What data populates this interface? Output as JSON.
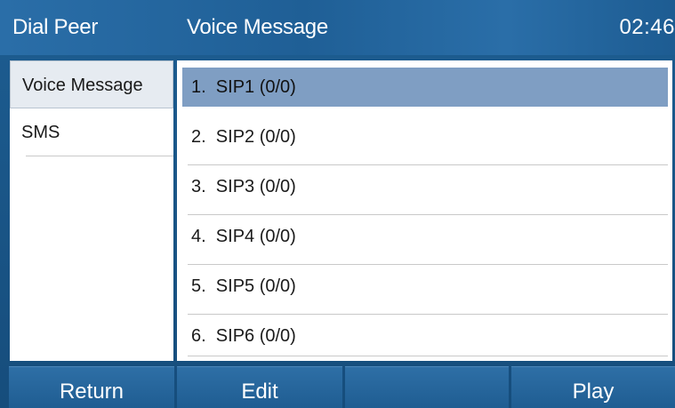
{
  "header": {
    "left_title": "Dial Peer",
    "center_title": "Voice Message",
    "time": "02:46"
  },
  "sidebar": {
    "items": [
      {
        "label": "Voice Message",
        "selected": true
      },
      {
        "label": "SMS",
        "selected": false
      }
    ]
  },
  "list": {
    "items": [
      {
        "label": "1.  SIP1 (0/0)",
        "selected": true
      },
      {
        "label": "2.  SIP2 (0/0)",
        "selected": false
      },
      {
        "label": "3.  SIP3 (0/0)",
        "selected": false
      },
      {
        "label": "4.  SIP4 (0/0)",
        "selected": false
      },
      {
        "label": "5.  SIP5 (0/0)",
        "selected": false
      },
      {
        "label": "6.  SIP6 (0/0)",
        "selected": false
      }
    ]
  },
  "softkeys": {
    "key1": "Return",
    "key2": "Edit",
    "key3": "",
    "key4": "Play"
  },
  "colors": {
    "title_bar": "#1f5f96",
    "selected_row": "#7f9ec3",
    "softkey": "#2e6fa6"
  }
}
